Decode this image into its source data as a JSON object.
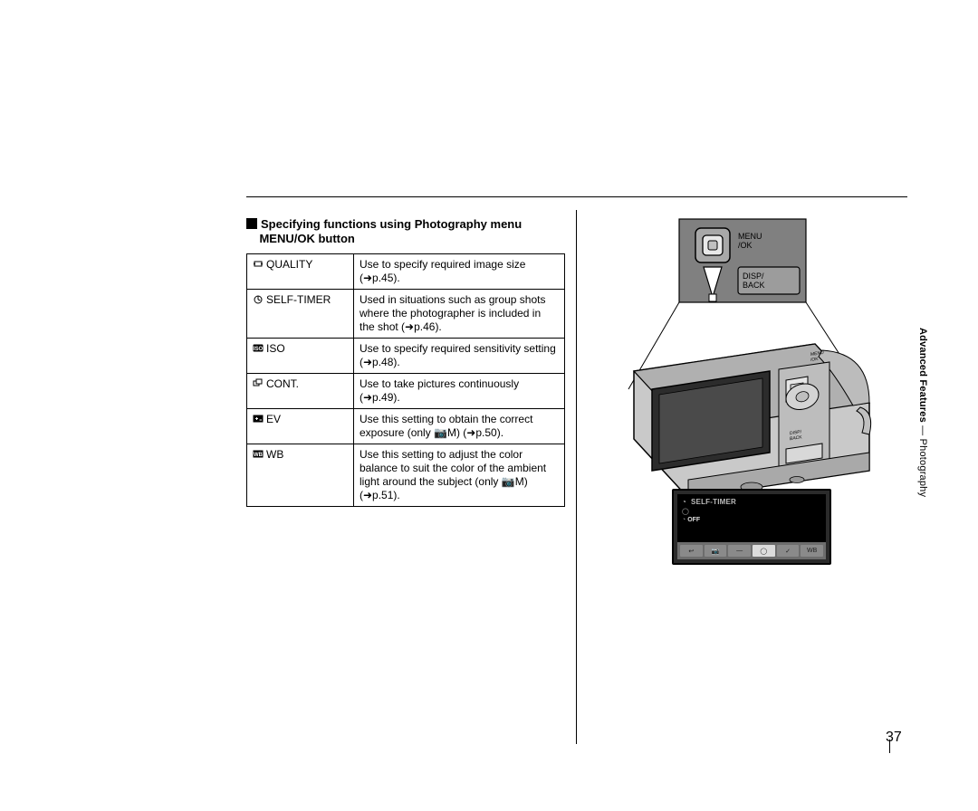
{
  "heading": {
    "line1": "Specifying functions using Photography menu",
    "line2": "MENU/OK button"
  },
  "table": {
    "rows": [
      {
        "icon": "quality-icon",
        "label": "QUALITY",
        "desc": "Use to specify required image size (➜p.45)."
      },
      {
        "icon": "self-timer-icon",
        "label": "SELF-TIMER",
        "desc": "Used in situations such as group shots where the photographer is included in the shot (➜p.46)."
      },
      {
        "icon": "iso-icon",
        "label": "ISO",
        "desc": "Use to specify required sensitivity setting (➜p.48)."
      },
      {
        "icon": "cont-icon",
        "label": "CONT.",
        "desc": "Use to take pictures continuously (➜p.49)."
      },
      {
        "icon": "ev-icon",
        "label": "EV",
        "desc": "Use this setting to obtain the correct exposure (only 📷M) (➜p.50)."
      },
      {
        "icon": "wb-icon",
        "label": "WB",
        "desc": "Use this setting to adjust the color balance to suit the color of the ambient light around the subject (only 📷M) (➜p.51)."
      }
    ]
  },
  "buttons_panel": {
    "menu_ok": "MENU\n/OK",
    "disp_back": "DISP/\nBACK"
  },
  "camera_back_labels": {
    "menu_ok": "MENU/OK",
    "disp_back": "DISP/BACK"
  },
  "menu_screen": {
    "title": "SELF-TIMER",
    "option_icon": "◯",
    "option_selected": "OFF",
    "tabs": [
      "↩",
      "📷",
      "—",
      "◯",
      "✓",
      "WB"
    ]
  },
  "side_label": {
    "bold": "Advanced Features",
    "sep": "—",
    "plain": "Photography"
  },
  "page_number": "37"
}
